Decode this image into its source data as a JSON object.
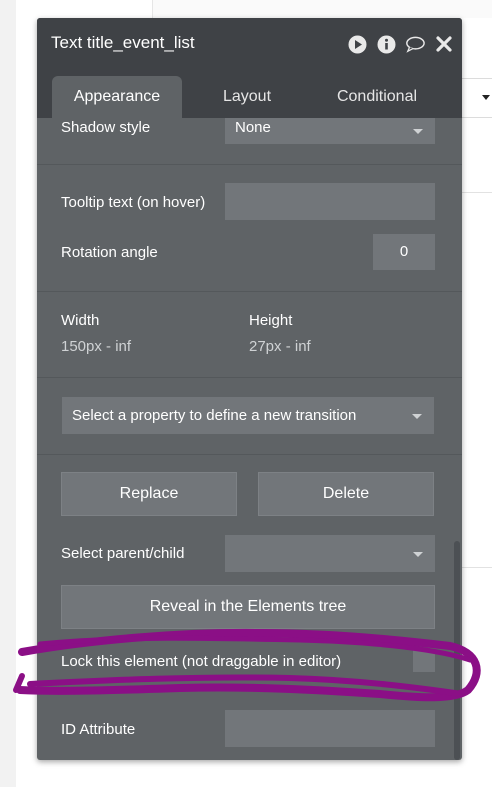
{
  "panel": {
    "title": "Text title_event_list",
    "header_icons": [
      "play-circle-icon",
      "info-circle-icon",
      "comment-icon",
      "close-icon"
    ]
  },
  "tabs": [
    {
      "label": "Appearance",
      "active": true
    },
    {
      "label": "Layout",
      "active": false
    },
    {
      "label": "Conditional",
      "active": false
    }
  ],
  "shadow_style": {
    "label": "Shadow style",
    "value": "None"
  },
  "tooltip": {
    "label": "Tooltip text (on hover)",
    "value": ""
  },
  "rotation": {
    "label": "Rotation angle",
    "value": "0"
  },
  "size": {
    "width_label": "Width",
    "width_value": "150px - inf",
    "height_label": "Height",
    "height_value": "27px - inf"
  },
  "transition": {
    "placeholder": "Select a property to define a new transition"
  },
  "buttons": {
    "replace": "Replace",
    "delete": "Delete",
    "reveal": "Reveal in the Elements tree"
  },
  "select_parent_child": {
    "label": "Select parent/child",
    "value": ""
  },
  "lock": {
    "label": "Lock this element (not draggable in editor)",
    "checked": false
  },
  "id_attribute": {
    "label": "ID Attribute",
    "value": ""
  },
  "colors": {
    "panel": "#5f6366",
    "header": "#3f4246",
    "field": "#72767a",
    "annotation": "#8b0f86"
  }
}
